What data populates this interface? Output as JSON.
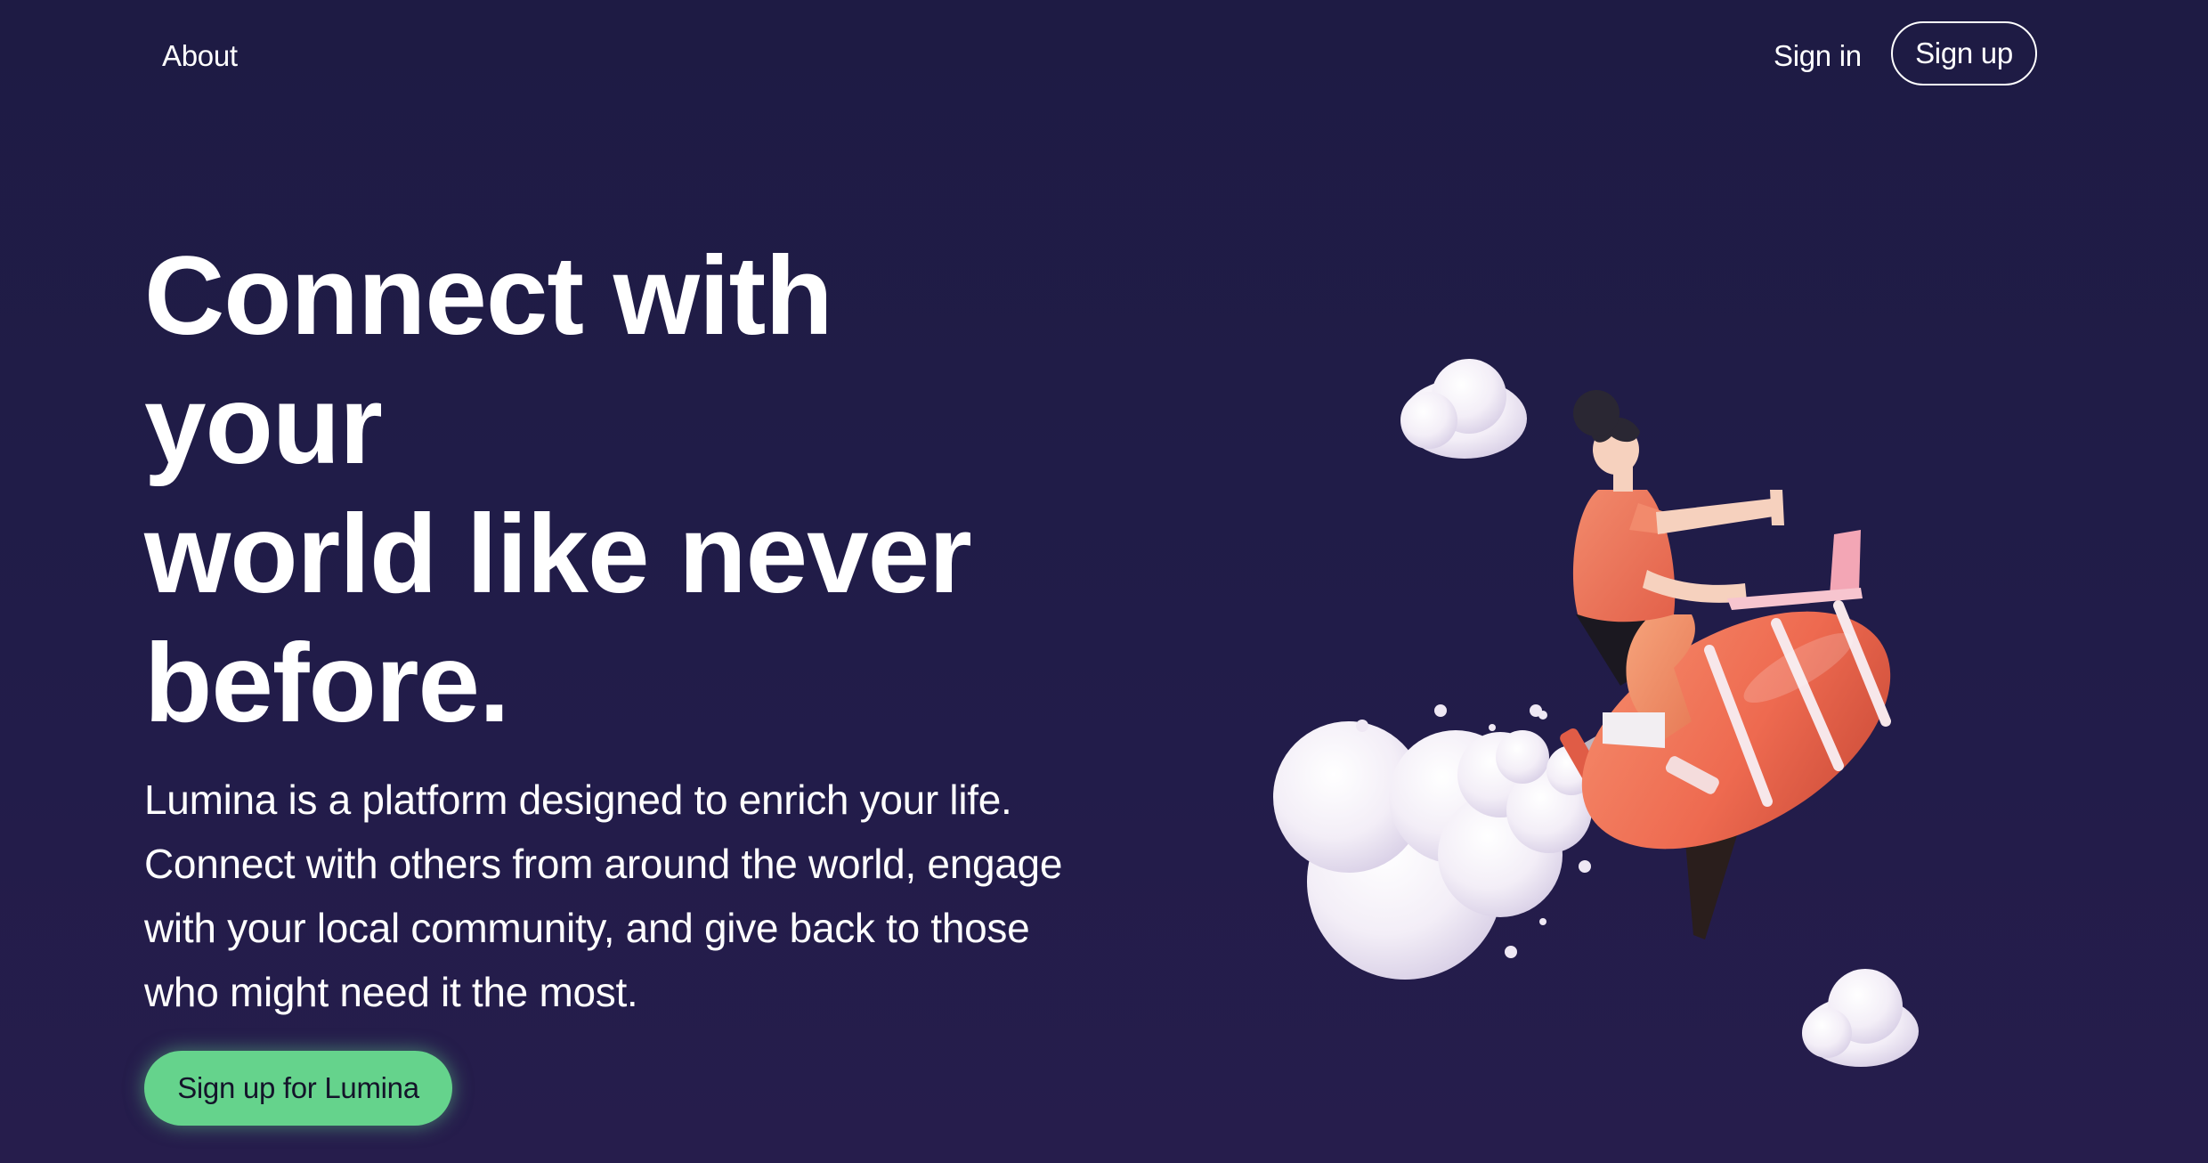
{
  "nav": {
    "about": "About",
    "sign_in": "Sign in",
    "sign_up": "Sign up"
  },
  "hero": {
    "title_lines": [
      "Connect with",
      "your",
      "world like never",
      "before."
    ],
    "description": "Lumina is a platform designed to enrich your life. Connect with others from around the world, engage with your local community, and give back to those who might need it the most.",
    "cta_label": "Sign up for Lumina"
  },
  "illustration": {
    "subject": "person-riding-rocket-with-clouds",
    "icons": [
      "cloud-icon",
      "rocket-icon",
      "laptop-icon"
    ]
  },
  "colors": {
    "background": "#1f1b46",
    "accent_green": "#65d38c",
    "rocket": "#ee6a50",
    "text": "#ffffff"
  }
}
